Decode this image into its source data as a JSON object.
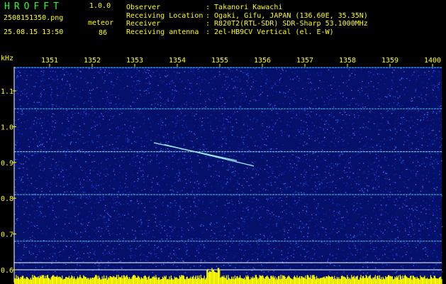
{
  "app": {
    "title": "HROFFT",
    "version": "1.0.0",
    "filename": "2508151350.png",
    "datetime": "25.08.15 13:50",
    "meteor_label": "meteor",
    "meteor_count": "86"
  },
  "info": [
    {
      "label": "Observer",
      "value": ": Takanori Kawachi"
    },
    {
      "label": "Receiving Location",
      "value": ": Ogaki, Gifu, JAPAN (136.60E, 35.35N)"
    },
    {
      "label": "Receiver",
      "value": ": R820T2(RTL-SDR) SDR-Sharp 53.1000MHz"
    },
    {
      "label": "Receiving antenna",
      "value": ": 2el-HB9CV Vertical (el. E-W)"
    }
  ],
  "colors": {
    "background": "#000000",
    "text": "#ffff00",
    "title": "#22ff22",
    "noise": "#0a1ea0",
    "trace": "#40e0ff",
    "bars": "#ffff00"
  },
  "chart_data": {
    "type": "heatmap",
    "y_unit_label": "kHz",
    "x_ticks": [
      "1351",
      "1352",
      "1353",
      "1354",
      "1355",
      "1356",
      "1357",
      "1358",
      "1359",
      "1400"
    ],
    "y_ticks": [
      "1.1",
      "1.0",
      "0.9",
      "0.8",
      "0.7",
      "0.6"
    ],
    "ylim": [
      0.58,
      1.17
    ],
    "horizontal_traces_khz": [
      1.165,
      1.05,
      0.93,
      0.81,
      0.68
    ],
    "meteor_trails": [
      {
        "x_start": 1353.45,
        "x_end": 1355.4,
        "y_start": 0.955,
        "y_end": 0.905
      },
      {
        "x_start": 1353.7,
        "x_end": 1355.8,
        "y_start": 0.95,
        "y_end": 0.89
      }
    ]
  }
}
